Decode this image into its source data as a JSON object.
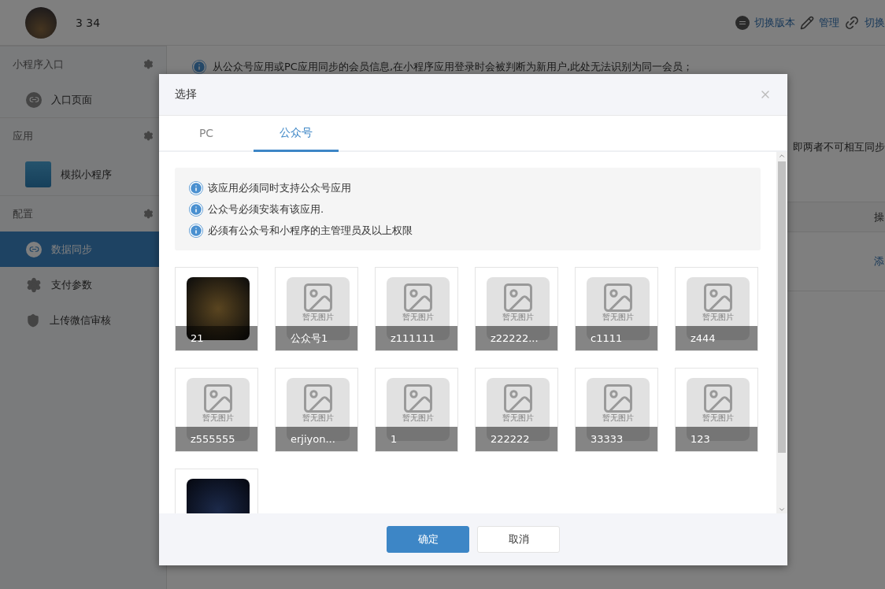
{
  "header": {
    "user_name": "3 34",
    "actions": [
      {
        "label": "切换版本",
        "kind": "version"
      },
      {
        "label": "管理",
        "kind": "edit"
      },
      {
        "label": "切换",
        "kind": "link"
      }
    ]
  },
  "sidebar": {
    "sections": [
      {
        "title": "小程序入口",
        "items": [
          {
            "label": "入口页面",
            "kind": "link",
            "selected": false
          }
        ]
      },
      {
        "title": "应用",
        "items": [
          {
            "label": "模拟小程序",
            "kind": "app",
            "selected": false
          }
        ]
      },
      {
        "title": "配置",
        "items": [
          {
            "label": "数据同步",
            "kind": "link",
            "selected": true
          },
          {
            "label": "支付参数",
            "kind": "gear",
            "selected": false
          },
          {
            "label": "上传微信审核",
            "kind": "shield",
            "selected": false
          }
        ]
      }
    ]
  },
  "main": {
    "notice": "从公众号应用或PC应用同步的会员信息,在小程序应用登录时会被判断为新用户,此处无法识别为同一会员；",
    "notice_tail": "即两者不可相互同步",
    "table": {
      "columns": [
        "操"
      ],
      "rows": [
        [
          "添"
        ]
      ]
    }
  },
  "dialog": {
    "title": "选择",
    "tabs": [
      {
        "label": "PC",
        "selected": false
      },
      {
        "label": "公众号",
        "selected": true
      }
    ],
    "tips": [
      "该应用必须同时支持公众号应用",
      "公众号必须安装有该应用.",
      "必须有公众号和小程序的主管理员及以上权限"
    ],
    "accounts": [
      {
        "kind": "photo",
        "name": "21"
      },
      {
        "kind": "placeholder",
        "caption": "暂无图片",
        "name": "公众号1"
      },
      {
        "kind": "placeholder",
        "caption": "暂无图片",
        "name": "z111111"
      },
      {
        "kind": "placeholder",
        "caption": "暂无图片",
        "name": "z22222..."
      },
      {
        "kind": "placeholder",
        "caption": "暂无图片",
        "name": "c1111"
      },
      {
        "kind": "placeholder",
        "caption": "暂无图片",
        "name": "z444"
      },
      {
        "kind": "placeholder",
        "caption": "暂无图片",
        "name": "z555555"
      },
      {
        "kind": "placeholder",
        "caption": "暂无图片",
        "name": "erjiyon..."
      },
      {
        "kind": "placeholder",
        "caption": "暂无图片",
        "name": "1"
      },
      {
        "kind": "placeholder",
        "caption": "暂无图片",
        "name": "222222"
      },
      {
        "kind": "placeholder",
        "caption": "暂无图片",
        "name": "33333"
      },
      {
        "kind": "placeholder",
        "caption": "暂无图片",
        "name": "123"
      },
      {
        "kind": "photo"
      }
    ],
    "buttons": [
      {
        "label": "确定",
        "kind": "primary"
      },
      {
        "label": "取消",
        "kind": "default"
      }
    ]
  }
}
